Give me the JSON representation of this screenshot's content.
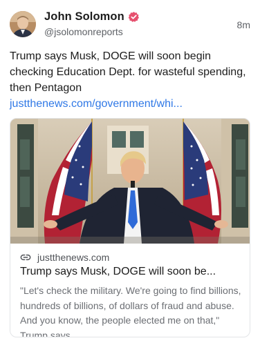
{
  "author": {
    "display_name": "John Solomon",
    "handle": "@jsolomonreports",
    "verified": true,
    "avatar_icon": "user-avatar"
  },
  "post": {
    "timestamp": "8m",
    "text": "Trump says Musk, DOGE will soon begin checking Education Dept. for wasteful spending, then Pentagon",
    "link_text": "justthenews.com/government/whi..."
  },
  "link_card": {
    "domain": "justthenews.com",
    "title": "Trump says Musk, DOGE will soon be...",
    "description": "\"Let's check the military. We're going to find billions, hundreds of billions, of dollars of fraud and abuse. And you know, the people elected me on that,\" Trump says",
    "link_icon": "link-icon"
  },
  "colors": {
    "verified_badge": "#e6506e",
    "link": "#2f78e6",
    "secondary_text": "#5e6166"
  }
}
